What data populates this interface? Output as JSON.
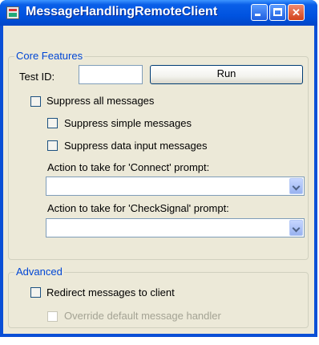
{
  "window": {
    "title": "MessageHandlingRemoteClient"
  },
  "core": {
    "group_label": "Core Features",
    "test_id_label": "Test ID:",
    "test_id_value": "",
    "run_label": "Run",
    "suppress_all_label": "Suppress all messages",
    "suppress_simple_label": "Suppress simple messages",
    "suppress_data_label": "Suppress data input messages",
    "connect_label": "Action to take for 'Connect' prompt:",
    "connect_value": "",
    "checksignal_label": "Action to take for 'CheckSignal' prompt:",
    "checksignal_value": ""
  },
  "advanced": {
    "group_label": "Advanced",
    "redirect_label": "Redirect messages to client",
    "override_label": "Override default message handler"
  }
}
